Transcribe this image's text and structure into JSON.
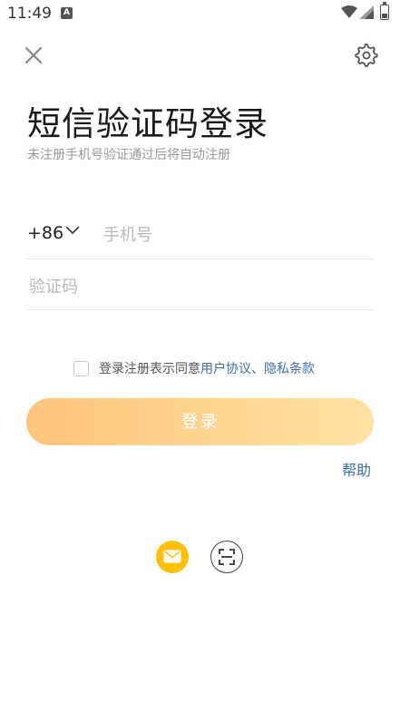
{
  "status_bar": {
    "time": "11:49",
    "notification_icon": "a-icon",
    "icons": [
      "wifi-icon",
      "signal-icon",
      "battery-icon"
    ]
  },
  "header": {
    "close_icon": "close-icon",
    "settings_icon": "gear-icon"
  },
  "main": {
    "title": "短信验证码登录",
    "subtitle": "未注册手机号验证通过后将自动注册"
  },
  "form": {
    "country_code": "+86",
    "phone_placeholder": "手机号",
    "phone_value": "",
    "code_placeholder": "验证码",
    "code_value": ""
  },
  "agreement": {
    "checked": false,
    "text": "登录注册表示同意",
    "user_agreement": "用户协议",
    "separator": "、",
    "privacy_policy": "隐私条款"
  },
  "login_button": {
    "label": "登录"
  },
  "help": {
    "label": "帮助"
  },
  "alt_login": {
    "items": [
      "email-icon",
      "scan-icon"
    ]
  },
  "colors": {
    "accent_link": "#3f6fa8",
    "button_gradient_start": "#ffc37d",
    "button_gradient_end": "#ffe2a2",
    "email_button": "#ffc107"
  }
}
